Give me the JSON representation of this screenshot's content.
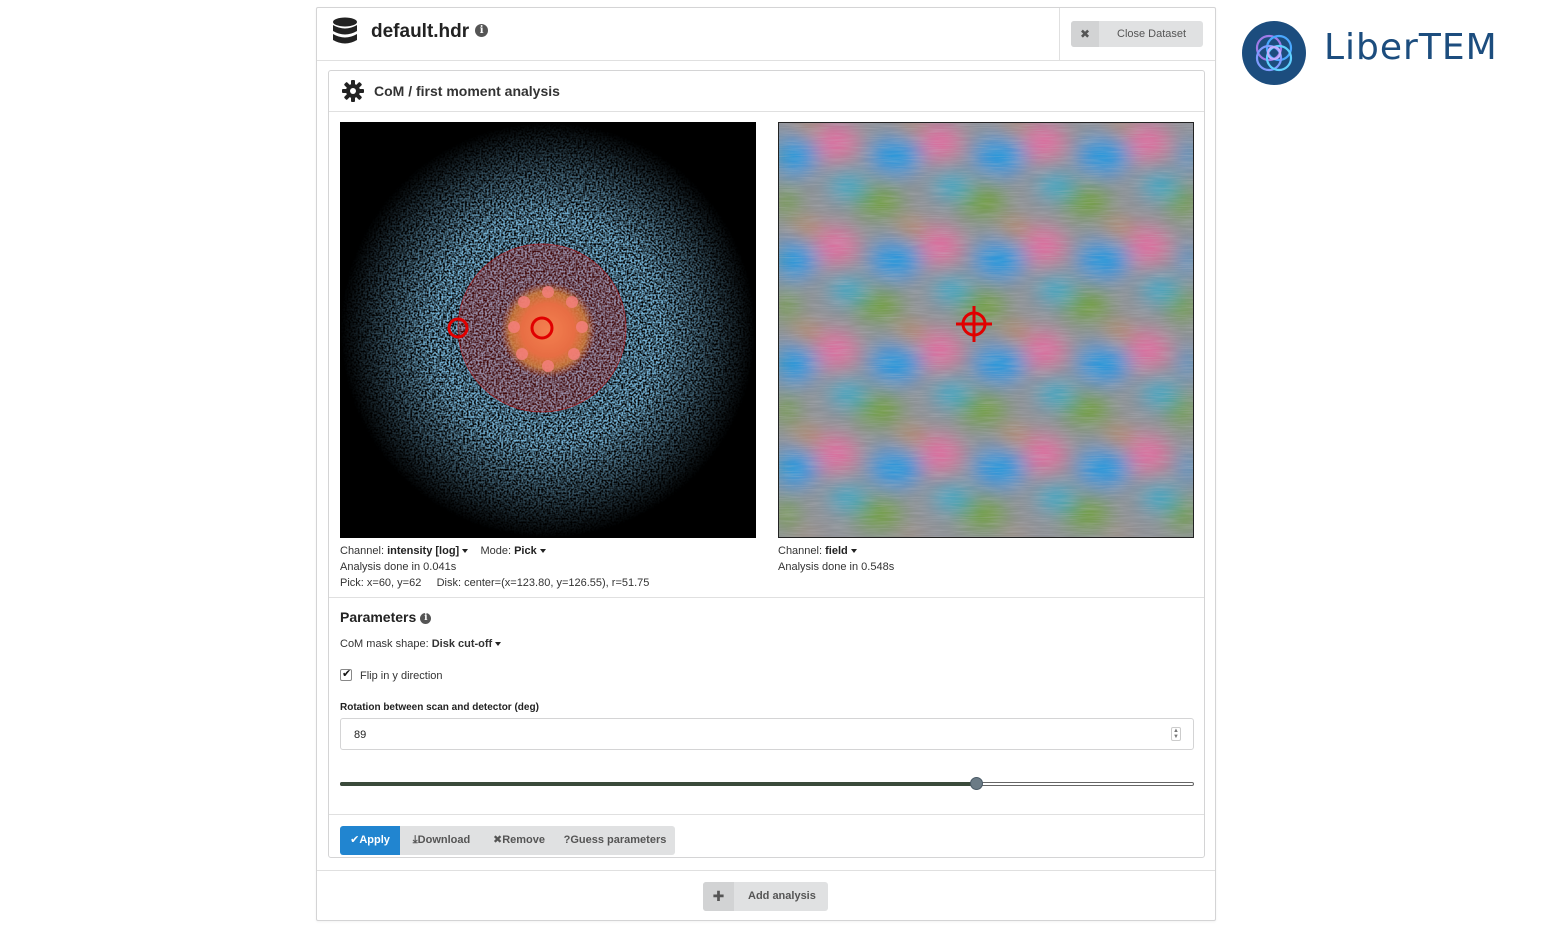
{
  "dataset": {
    "title": "default.hdr",
    "close_label": "Close Dataset"
  },
  "analysis": {
    "title": "CoM / first moment analysis",
    "left": {
      "channel_label": "Channel:",
      "channel_value": "intensity [log]",
      "mode_label": "Mode:",
      "mode_value": "Pick",
      "status": "Analysis done in 0.041s",
      "pick": "Pick: x=60, y=62",
      "disk": "Disk: center=(x=123.80, y=126.55), r=51.75"
    },
    "right": {
      "channel_label": "Channel:",
      "channel_value": "field",
      "status": "Analysis done in 0.548s"
    },
    "parameters": {
      "title": "Parameters",
      "mask_label": "CoM mask shape:",
      "mask_value": "Disk cut-off",
      "flip_label": "Flip in y direction",
      "flip_checked": true,
      "rotation_label": "Rotation between scan and detector (deg)",
      "rotation_value": "89",
      "rotation_slider_fraction": 0.745
    },
    "buttons": {
      "apply": "Apply",
      "download": "Download",
      "remove": "Remove",
      "guess": "Guess parameters"
    }
  },
  "add_analysis_label": "Add analysis",
  "logo_text": "LiberTEM",
  "colors": {
    "primary": "#2185d0",
    "marker": "#e00000",
    "logo": "#1c4d7e"
  }
}
